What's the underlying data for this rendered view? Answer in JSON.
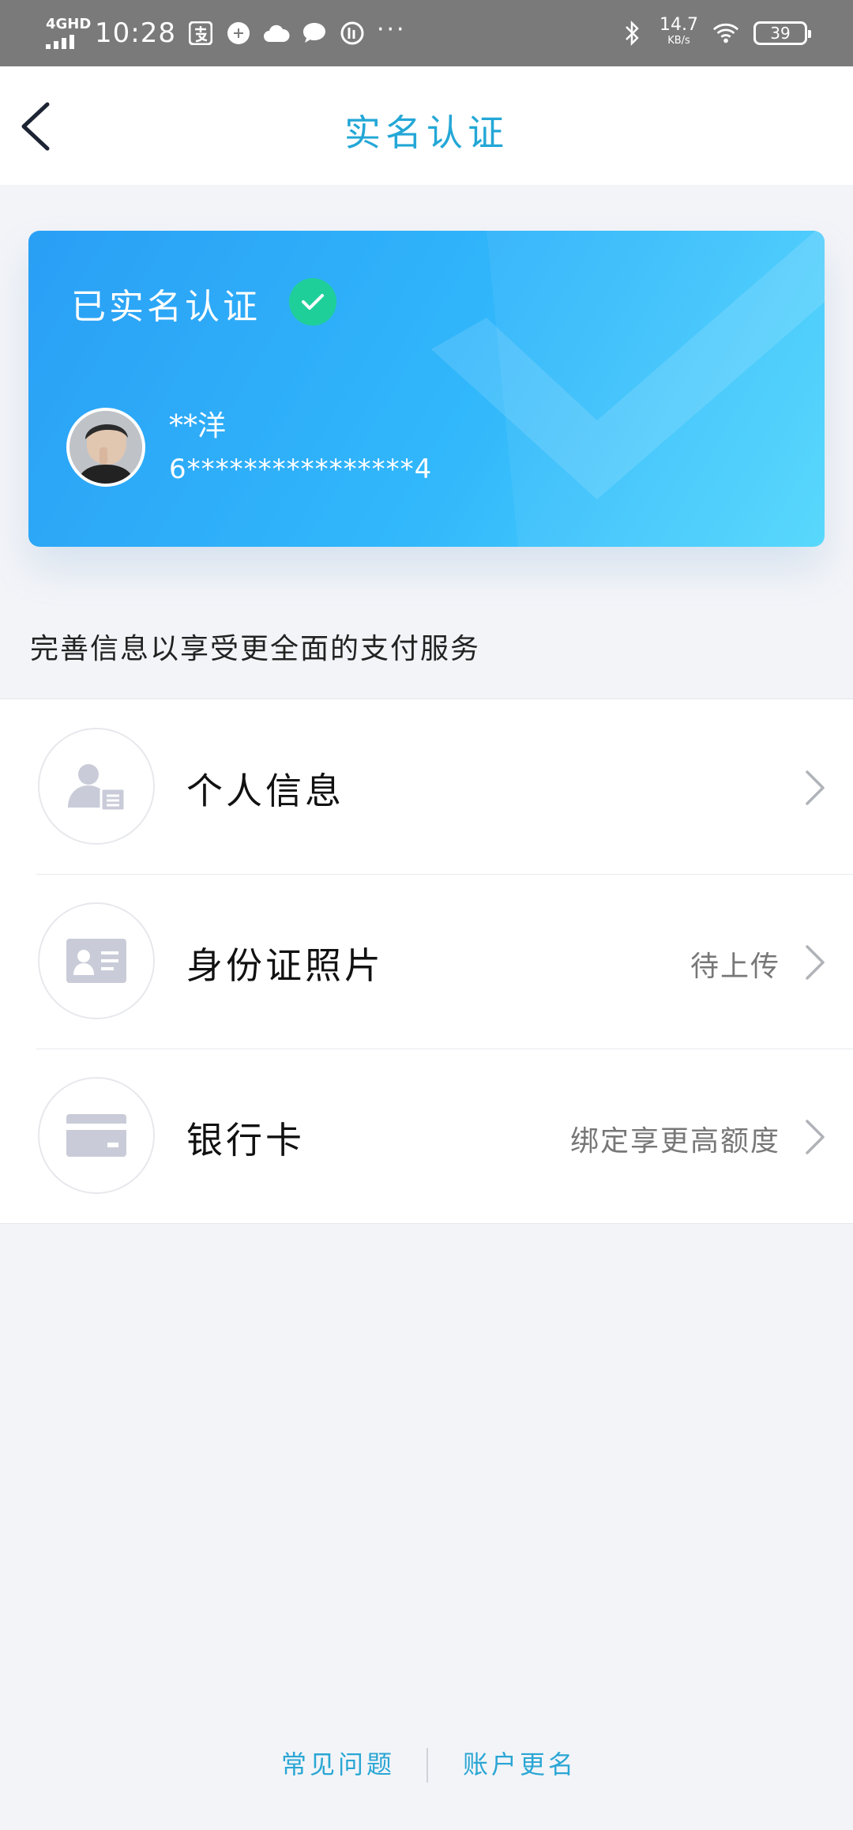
{
  "status_bar": {
    "network": "4GHD",
    "time": "10:28",
    "app_icons": [
      "alipay-icon",
      "chat-bubble-icon",
      "cloud-icon",
      "message-icon",
      "sync-icon"
    ],
    "more": "···",
    "speed_value": "14.7",
    "speed_unit": "KB/s",
    "battery": "39"
  },
  "header": {
    "title": "实名认证"
  },
  "card": {
    "status": "已实名认证",
    "name": "**洋",
    "id_number": "6****************4"
  },
  "tip": "完善信息以享受更全面的支付服务",
  "list": [
    {
      "label": "个人信息",
      "status": "",
      "icon": "person-card-icon"
    },
    {
      "label": "身份证照片",
      "status": "待上传",
      "icon": "id-card-icon"
    },
    {
      "label": "银行卡",
      "status": "绑定享更高额度",
      "icon": "bank-card-icon"
    }
  ],
  "footer": {
    "faq": "常见问题",
    "rename": "账户更名"
  },
  "colors": {
    "accent": "#23a7d6",
    "card_start": "#2a9ff5",
    "card_end": "#4fd6fc",
    "check_green": "#1fcf9a",
    "background": "#f3f4f8",
    "icon_gray": "#c9ccd8"
  }
}
